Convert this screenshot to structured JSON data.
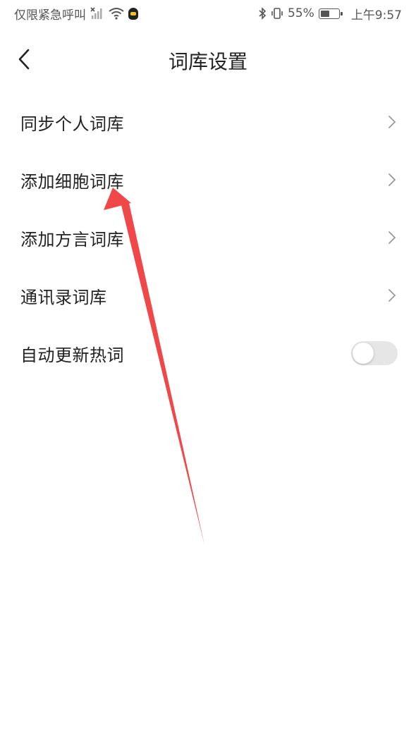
{
  "status_bar": {
    "carrier": "仅限紧急呼叫",
    "battery_percent": "55%",
    "time": "上午9:57",
    "battery_level": 0.55,
    "icons": [
      "signal-crossed-icon",
      "wifi-icon",
      "qq-icon",
      "bluetooth-icon",
      "vibrate-icon",
      "battery-icon"
    ]
  },
  "header": {
    "title": "词库设置",
    "back_icon": "chevron-left-icon"
  },
  "settings": {
    "items": [
      {
        "label": "同步个人词库",
        "control": "chevron"
      },
      {
        "label": "添加细胞词库",
        "control": "chevron"
      },
      {
        "label": "添加方言词库",
        "control": "chevron"
      },
      {
        "label": "通讯录词库",
        "control": "chevron"
      },
      {
        "label": "自动更新热词",
        "control": "toggle",
        "enabled": false
      }
    ]
  },
  "annotation": {
    "type": "red-arrow",
    "color": "#f04848",
    "points_to": "添加细胞词库"
  }
}
